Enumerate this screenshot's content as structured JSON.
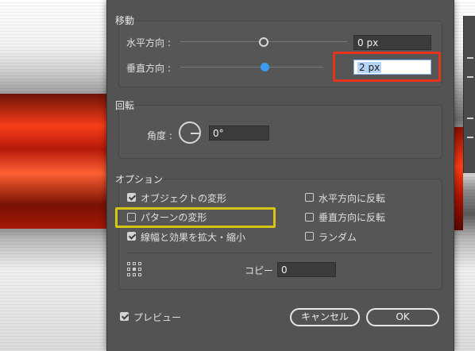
{
  "move": {
    "title": "移動",
    "horizontal_label": "水平方向 :",
    "horizontal_value": "0 px",
    "vertical_label": "垂直方向 :",
    "vertical_value": "2 px"
  },
  "rotate": {
    "title": "回転",
    "angle_label": "角度 :",
    "angle_value": "0°"
  },
  "options": {
    "title": "オプション",
    "transform_objects": {
      "label": "オブジェクトの変形",
      "checked": true
    },
    "transform_patterns": {
      "label": "パターンの変形",
      "checked": false
    },
    "scale_strokes": {
      "label": "線幅と効果を拡大・縮小",
      "checked": true
    },
    "reflect_horizontal": {
      "label": "水平方向に反転",
      "checked": false
    },
    "reflect_vertical": {
      "label": "垂直方向に反転",
      "checked": false
    },
    "random": {
      "label": "ランダム",
      "checked": false
    },
    "copies_label": "コピー",
    "copies_value": "0"
  },
  "footer": {
    "preview_label": "プレビュー",
    "cancel_label": "キャンセル",
    "ok_label": "OK"
  },
  "colors": {
    "dialog_bg": "#535353",
    "accent_blue": "#3a9bf0",
    "highlight_red": "#e5341b",
    "highlight_yellow": "#d6c514"
  }
}
